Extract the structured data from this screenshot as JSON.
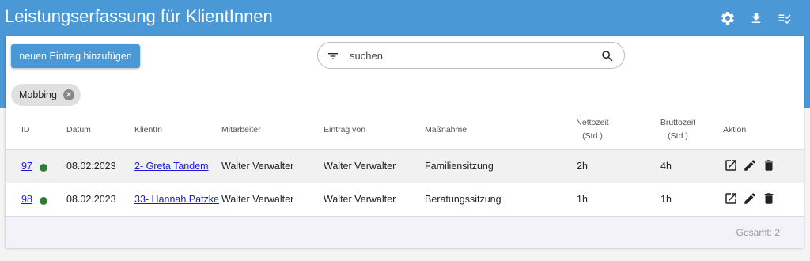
{
  "app": {
    "title": "Leistungserfassung für KlientInnen"
  },
  "toolbar": {
    "icons": [
      "gear-icon",
      "download-icon",
      "checklist-icon"
    ]
  },
  "actions": {
    "add_label": "neuen Eintrag hinzufügen"
  },
  "search": {
    "placeholder": "suchen",
    "value": ""
  },
  "filter_chip": {
    "label": "Mobbing"
  },
  "table": {
    "headers": {
      "id": "ID",
      "datum": "Datum",
      "klient": "KlientIn",
      "mitarbeiter": "Mitarbeiter",
      "eintrag_von": "Eintrag von",
      "massnahme": "Maßnahme",
      "netto_1": "Nettozeit",
      "netto_2": "(Std.)",
      "brutto_1": "Bruttozeit",
      "brutto_2": "(Std.)",
      "aktion": "Aktion"
    },
    "rows": [
      {
        "id": "97",
        "status_color": "#2e7d32",
        "datum": "08.02.2023",
        "klient": "2- Greta Tandem",
        "mitarbeiter": "Walter Verwalter",
        "eintrag_von": "Walter Verwalter",
        "massnahme": "Familiensitzung",
        "netto": "2h",
        "brutto": "4h"
      },
      {
        "id": "98",
        "status_color": "#2e7d32",
        "datum": "08.02.2023",
        "klient": "33- Hannah Patzke",
        "mitarbeiter": "Walter Verwalter",
        "eintrag_von": "Walter Verwalter",
        "massnahme": "Beratungssitzung",
        "netto": "1h",
        "brutto": "1h"
      }
    ]
  },
  "footer": {
    "total": "Gesamt:  2"
  },
  "colors": {
    "primary": "#4a98d6",
    "status_ok": "#2e7d32",
    "link": "#1a1add"
  }
}
